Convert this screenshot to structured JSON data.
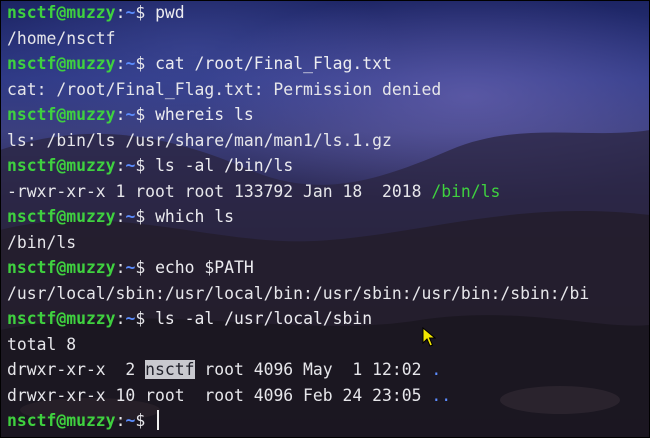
{
  "terminal": {
    "user_host": "nsctf@muzzy",
    "home_path": "~",
    "lines": [
      {
        "cmd": "pwd"
      },
      {
        "out": "/home/nsctf"
      },
      {
        "cmd": "cat /root/Final_Flag.txt"
      },
      {
        "out": "cat: /root/Final_Flag.txt: Permission denied"
      },
      {
        "cmd": "whereis ls"
      },
      {
        "out": "ls: /bin/ls /usr/share/man/man1/ls.1.gz"
      },
      {
        "cmd": "ls -al /bin/ls"
      },
      {
        "out": "-rwxr-xr-x 1 root root 133792 Jan 18  2018 ",
        "link": "/bin/ls"
      },
      {
        "cmd": "which ls"
      },
      {
        "out": "/bin/ls"
      },
      {
        "cmd": "echo $PATH"
      },
      {
        "out": "/usr/local/sbin:/usr/local/bin:/usr/sbin:/usr/bin:/sbin:/bi"
      },
      {
        "cmd": "ls -al /usr/local/sbin"
      },
      {
        "out": "total 8"
      },
      {
        "perm": "drwxr-xr-x  2 ",
        "owner": "nsctf",
        "rest": " root 4096 May  1 12:02 ",
        "name": "."
      },
      {
        "perm": "drwxr-xr-x 10 ",
        "owner": "root ",
        "rest": " root 4096 Feb 24 23:05 ",
        "name": ".."
      },
      {
        "cmd": "",
        "cursor": true
      }
    ]
  },
  "colors": {
    "prompt_user": "#3fd13f",
    "prompt_path": "#5c8dff",
    "text": "#e8e8ec",
    "highlight": "#c9c9cf"
  },
  "icons": {
    "pointer": "mouse-pointer-icon"
  }
}
